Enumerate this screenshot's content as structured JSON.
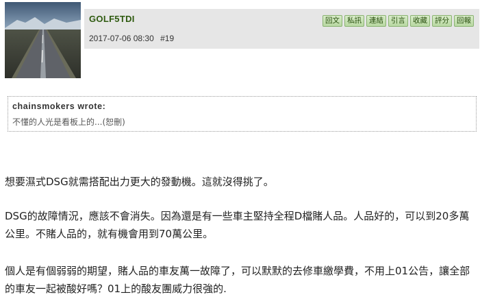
{
  "post": {
    "username": "GOLF5TDI",
    "datetime": "2017-07-06 08:30",
    "floor": "#19",
    "actions": [
      "回文",
      "私訊",
      "連結",
      "引言",
      "收藏",
      "評分",
      "回報"
    ]
  },
  "quote": {
    "author": "chainsmokers wrote:",
    "text": "不懂的人光是看板上的...(恕刪)"
  },
  "body": {
    "paragraphs": [
      "想要濕式DSG就需搭配出力更大的發動機。這就沒得挑了。",
      "DSG的故障情況，應該不會消失。因為還是有一些車主堅持全程D檔賭人品。人品好的，可以到20多萬公里。不賭人品的，就有機會用到70萬公里。",
      "個人是有個弱弱的期望，賭人品的車友萬一故障了，可以默默的去修車繳學費，不用上01公告，讓全部的車友一起被酸好嗎？01上的酸友團威力很強的."
    ]
  }
}
